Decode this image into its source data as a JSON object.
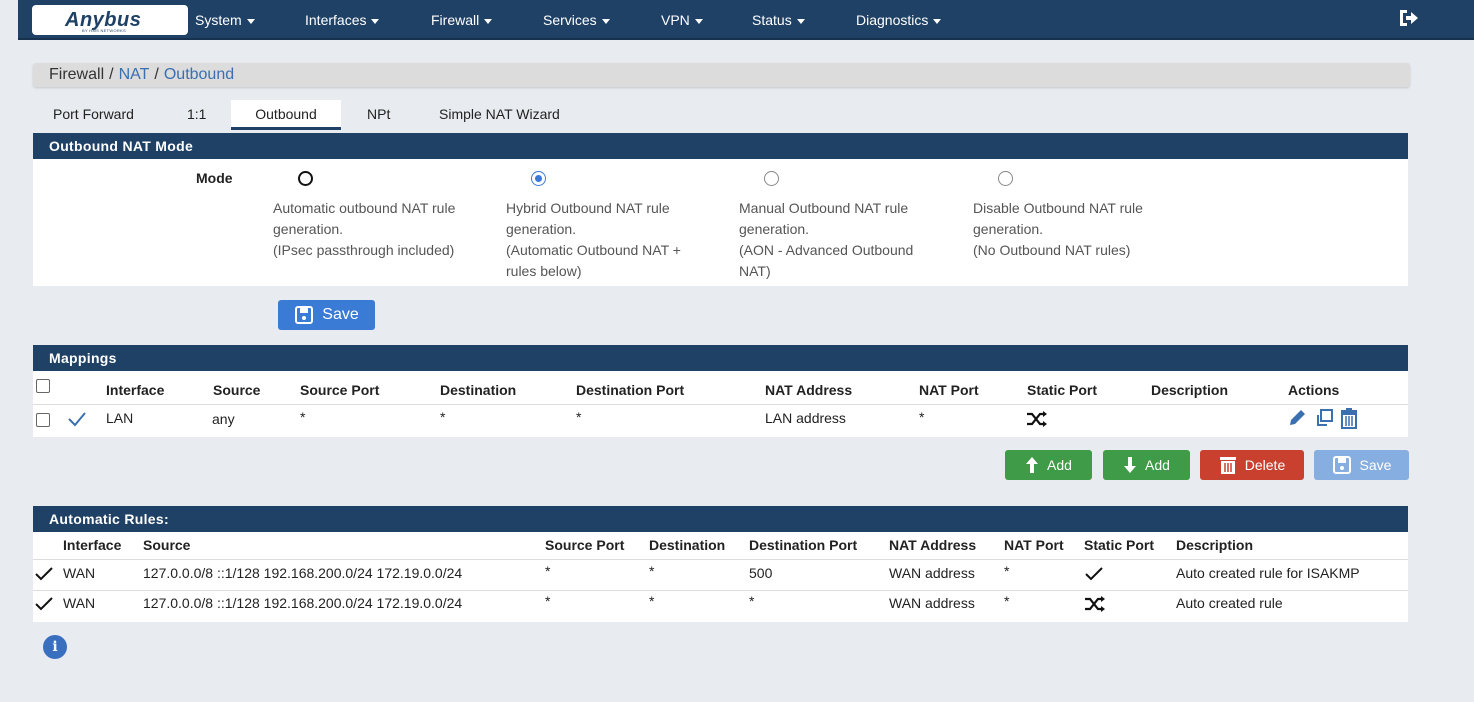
{
  "brand": {
    "logo": "Anybus",
    "tagline": "BY HMS NETWORKS"
  },
  "nav": {
    "items": [
      "System",
      "Interfaces",
      "Firewall",
      "Services",
      "VPN",
      "Status",
      "Diagnostics"
    ]
  },
  "breadcrumb": {
    "root": "Firewall",
    "level1": "NAT",
    "level2": "Outbound",
    "sep": "/"
  },
  "tabs": [
    "Port Forward",
    "1:1",
    "Outbound",
    "NPt",
    "Simple NAT Wizard"
  ],
  "outbound_mode": {
    "title": "Outbound NAT Mode",
    "label": "Mode",
    "options": [
      {
        "lines": [
          "Automatic outbound NAT rule",
          "generation.",
          "(IPsec passthrough included)"
        ]
      },
      {
        "lines": [
          "Hybrid Outbound NAT rule",
          "generation.",
          "(Automatic Outbound NAT +",
          "rules below)"
        ]
      },
      {
        "lines": [
          "Manual Outbound NAT rule",
          "generation.",
          "(AON - Advanced Outbound",
          "NAT)"
        ]
      },
      {
        "lines": [
          "Disable Outbound NAT rule",
          "generation.",
          "(No Outbound NAT rules)"
        ]
      }
    ],
    "selected_index": 1,
    "save_label": "Save"
  },
  "mappings": {
    "title": "Mappings",
    "columns": [
      "Interface",
      "Source",
      "Source Port",
      "Destination",
      "Destination Port",
      "NAT Address",
      "NAT Port",
      "Static Port",
      "Description",
      "Actions"
    ],
    "rows": [
      {
        "interface": "LAN",
        "source": "any",
        "source_port": "*",
        "destination": "*",
        "destination_port": "*",
        "nat_address": "LAN address",
        "nat_port": "*",
        "static_port": "shuffle",
        "description": ""
      }
    ],
    "buttons": {
      "add_top": "Add",
      "add_bottom": "Add",
      "delete": "Delete",
      "save": "Save"
    }
  },
  "automatic_rules": {
    "title": "Automatic Rules:",
    "columns": [
      "Interface",
      "Source",
      "Source Port",
      "Destination",
      "Destination Port",
      "NAT Address",
      "NAT Port",
      "Static Port",
      "Description"
    ],
    "rows": [
      {
        "interface": "WAN",
        "source": "127.0.0.0/8 ::1/128 192.168.200.0/24 172.19.0.0/24",
        "source_port": "*",
        "destination": "*",
        "destination_port": "500",
        "nat_address": "WAN address",
        "nat_port": "*",
        "static_port": "check",
        "description": "Auto created rule for ISAKMP"
      },
      {
        "interface": "WAN",
        "source": "127.0.0.0/8 ::1/128 192.168.200.0/24 172.19.0.0/24",
        "source_port": "*",
        "destination": "*",
        "destination_port": "*",
        "nat_address": "WAN address",
        "nat_port": "*",
        "static_port": "shuffle",
        "description": "Auto created rule"
      }
    ]
  },
  "info": {
    "glyph": "i"
  },
  "colors": {
    "navbar": "#1f4166",
    "primary": "#3a7bd5",
    "success": "#3f9b47",
    "danger": "#c9402f",
    "link": "#3a6fb0"
  }
}
